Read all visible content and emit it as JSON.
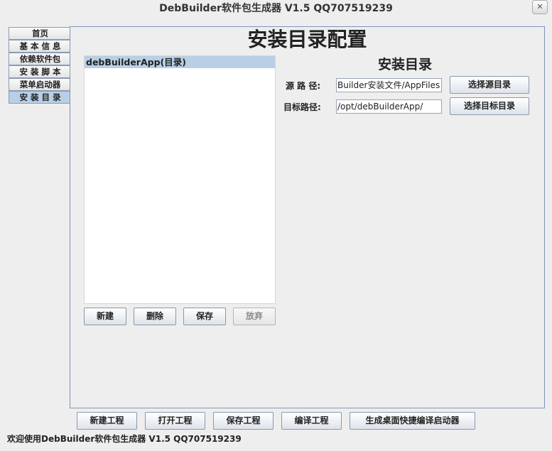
{
  "window": {
    "title": "DebBuilder软件包生成器 V1.5 QQ707519239",
    "close_glyph": "✕"
  },
  "tabs": [
    {
      "label": "首页"
    },
    {
      "label": "基 本 信 息"
    },
    {
      "label": "依赖软件包"
    },
    {
      "label": "安 装 脚 本"
    },
    {
      "label": "菜单启动器"
    },
    {
      "label": "安 装 目 录"
    }
  ],
  "active_tab": 5,
  "panel": {
    "title": "安装目录配置",
    "list_items": [
      "debBuilderApp(目录)"
    ],
    "list_buttons": {
      "new": "新建",
      "delete": "删除",
      "save": "保存",
      "discard": "放弃"
    },
    "section_title": "安装目录",
    "source": {
      "label": "源 路 径:",
      "value": "Builder安装文件/AppFiles",
      "button": "选择源目录"
    },
    "target": {
      "label": "目标路径:",
      "value": "/opt/debBuilderApp/",
      "button": "选择目标目录"
    }
  },
  "footer_buttons": {
    "new_project": "新建工程",
    "open_project": "打开工程",
    "save_project": "保存工程",
    "compile_project": "编译工程",
    "create_launcher": "生成桌面快捷编译启动器"
  },
  "status_text": "欢迎使用DebBuilder软件包生成器 V1.5 QQ707519239",
  "colors": {
    "selection": "#b8cfe5",
    "panel_border": "#7f95b8",
    "background": "#eeeeee"
  }
}
